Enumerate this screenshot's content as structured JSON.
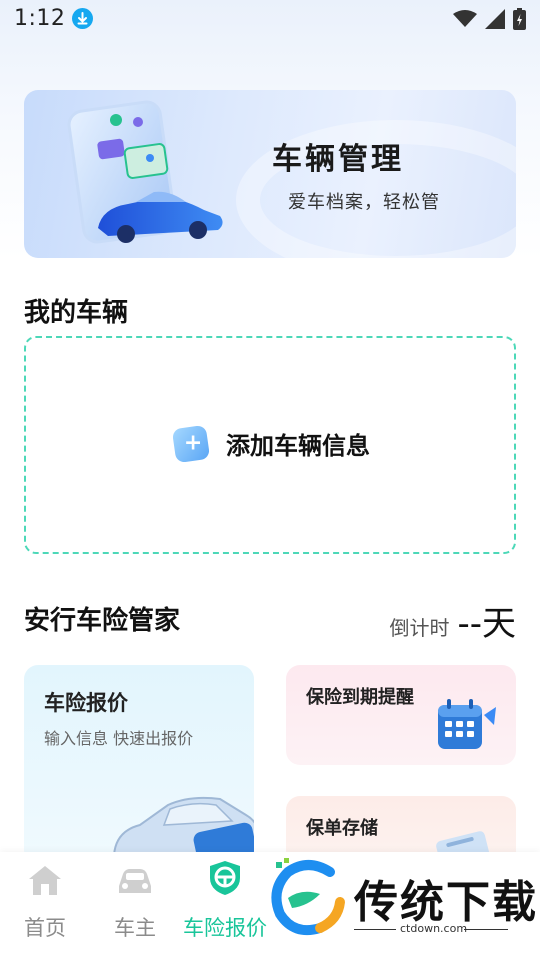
{
  "status_bar": {
    "time": "1:12"
  },
  "banner": {
    "title": "车辆管理",
    "subtitle": "爱车档案，轻松管"
  },
  "my_vehicle": {
    "title": "我的车辆",
    "add_label": "添加车辆信息"
  },
  "insurance": {
    "title": "安行车险管家",
    "countdown_label": "倒计时",
    "countdown_value": "--天",
    "quote_card": {
      "title": "车险报价",
      "subtitle": "输入信息 快速出报价"
    },
    "remind_card": {
      "title": "保险到期提醒"
    },
    "policy_card": {
      "title": "保单存储"
    }
  },
  "bottom_nav": {
    "items": [
      {
        "label": "首页",
        "icon": "home-icon"
      },
      {
        "label": "车主",
        "icon": "car-icon"
      },
      {
        "label": "车险报价",
        "icon": "shield-steering-icon"
      }
    ],
    "active_index": 2
  },
  "watermark": {
    "text": "传统下载",
    "url": "ctdown.com"
  },
  "colors": {
    "accent": "#19c59a",
    "dashed_border": "#4dd8b8",
    "download_badge": "#16a8f0"
  }
}
